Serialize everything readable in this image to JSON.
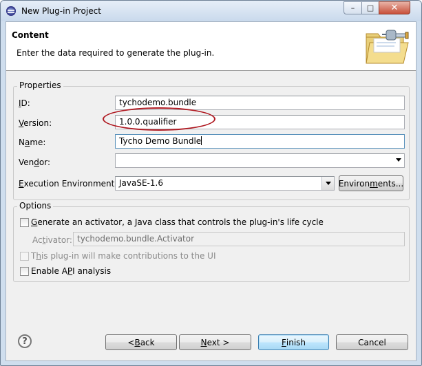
{
  "window": {
    "title": "New Plug-in Project",
    "controls": {
      "minimize": "–",
      "maximize": "□",
      "close": "✕"
    }
  },
  "banner": {
    "title": "Content",
    "description": "Enter the data required to generate the plug-in.",
    "image_icon": "folder-plug-icon"
  },
  "properties": {
    "group_title": "Properties",
    "id": {
      "label_key": "I",
      "label_rest": "D:",
      "value": "tychodemo.bundle"
    },
    "version": {
      "label_key": "V",
      "label_rest": "ersion:",
      "value": "1.0.0.qualifier"
    },
    "name": {
      "label_pre": "N",
      "label_key": "a",
      "label_rest": "me:",
      "value": "Tycho Demo Bundle"
    },
    "vendor": {
      "label_pre": "Ven",
      "label_key": "d",
      "label_rest": "or:",
      "value": ""
    },
    "execution_environment": {
      "label_key": "E",
      "label_rest": "xecution Environment:",
      "value": "JavaSE-1.6"
    },
    "environments_button": {
      "label_pre": "Environ",
      "label_key": "m",
      "label_rest": "ents..."
    }
  },
  "options": {
    "group_title": "Options",
    "generate_activator": {
      "label_key": "G",
      "label_rest": "enerate an activator, a Java class that controls the plug-in's life cycle",
      "checked": false
    },
    "activator": {
      "label_pre": "Ac",
      "label_key": "t",
      "label_rest": "ivator:",
      "value": "tychodemo.bundle.Activator"
    },
    "ui_contributions": {
      "label_pre": "T",
      "label_key": "h",
      "label_rest": "is plug-in will make contributions to the UI",
      "checked": false,
      "enabled": false
    },
    "api_analysis": {
      "label_pre": "Enable A",
      "label_key": "P",
      "label_rest": "I analysis",
      "checked": false
    }
  },
  "footer": {
    "help": "?",
    "back": {
      "label_pre": "< ",
      "label_key": "B",
      "label_rest": "ack"
    },
    "next": {
      "label_key": "N",
      "label_rest": "ext >"
    },
    "finish": {
      "label_key": "F",
      "label_rest": "inish"
    },
    "cancel": {
      "label": "Cancel"
    }
  },
  "colors": {
    "annotation": "#b01a22",
    "default_button": "#3c7fb1"
  }
}
